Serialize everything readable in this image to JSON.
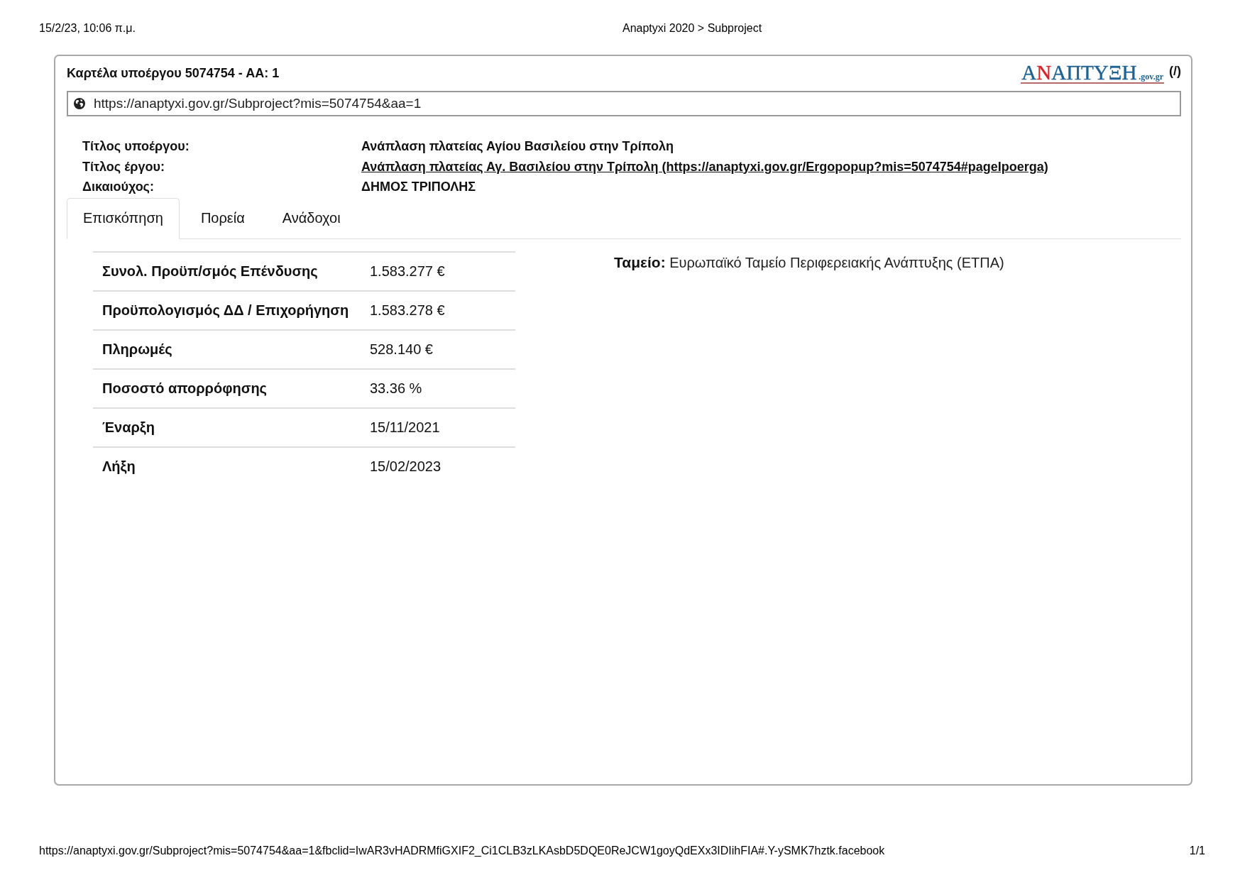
{
  "print_header": {
    "date": "15/2/23, 10:06 π.μ.",
    "title": "Anaptyxi 2020 > Subproject"
  },
  "card": {
    "title": "Καρτέλα υποέργου 5074754 - ΑΑ: 1",
    "logo": {
      "parts": [
        {
          "text": "Α",
          "color": "#1d6293"
        },
        {
          "text": "Ν",
          "color": "#d6262c"
        },
        {
          "text": "ΑΠΤΥΞΗ",
          "color": "#1d6293"
        }
      ],
      "domain": ".gov.gr"
    },
    "home_link": "(/)",
    "url": "https://anaptyxi.gov.gr/Subproject?mis=5074754&aa=1",
    "details": [
      {
        "kind": "text",
        "label": "Τίτλος υποέργου:",
        "value": "Ανάπλαση πλατείας Αγίου Βασιλείου στην Τρίπολη"
      },
      {
        "kind": "link",
        "label": "Τίτλος έργου:",
        "value": "Ανάπλαση πλατείας Αγ. Βασιλείου στην Τρίπολη (https://anaptyxi.gov.gr/Ergopopup?mis=5074754#pageIpoerga)"
      },
      {
        "kind": "text",
        "label": "Δικαιούχος:",
        "value": "ΔΗΜΟΣ ΤΡΙΠΟΛΗΣ"
      }
    ],
    "tabs": [
      {
        "label": "Επισκόπηση",
        "selected": true
      },
      {
        "label": "Πορεία",
        "selected": false
      },
      {
        "label": "Ανάδοχοι",
        "selected": false
      }
    ],
    "summary_table": {
      "rows": [
        {
          "label": "Συνολ. Προϋπ/σμός Επένδυσης",
          "value": "1.583.277 €"
        },
        {
          "label": "Προϋπολογισμός ΔΔ / Επιχορήγηση",
          "value": "1.583.278 €"
        },
        {
          "label": "Πληρωμές",
          "value": "528.140 €"
        },
        {
          "label": "Ποσοστό απορρόφησης",
          "value": "33.36 %"
        },
        {
          "label": "Έναρξη",
          "value": "15/11/2021"
        },
        {
          "label": "Λήξη",
          "value": "15/02/2023"
        }
      ]
    },
    "fund": "**Ταμείο:** Ευρωπαϊκό Ταμείο Περιφερειακής Ανάπτυξης (ΕΤΠΑ)"
  },
  "print_footer": {
    "url": "https://anaptyxi.gov.gr/Subproject?mis=5074754&aa=1&fbclid=IwAR3vHADRMfiGXIF2_Ci1CLB3zLKAsbD5DQE0ReJCW1goyQdEXx3IDIihFIA#.Y-ySMK7hztk.facebook",
    "page": "1/1"
  }
}
